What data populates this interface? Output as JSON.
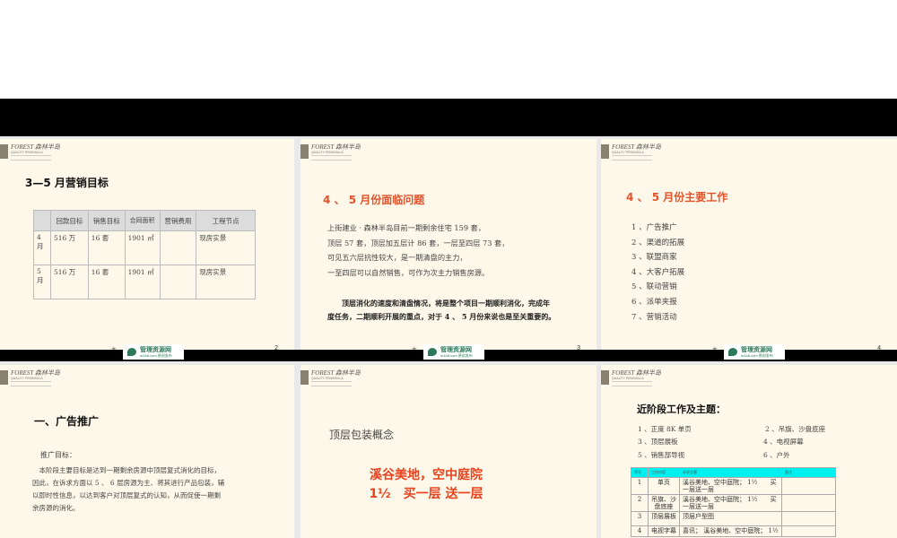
{
  "logo": {
    "brand": "FOREST 森林半岛",
    "sub": "QUALITY PENINSULA"
  },
  "watermark": {
    "name": "管理资源网",
    "url": "m448.com 原创发布"
  },
  "footer_text": "- 本",
  "slide2": {
    "title": "3—5 月营销目标",
    "page": "2",
    "table": {
      "headers": [
        "",
        "回款目标",
        "销售目标",
        "合同面积",
        "营销费用",
        "工程节点"
      ],
      "rows": [
        [
          "4月",
          "516 万",
          "16 套",
          "1901 ㎡",
          "",
          "现房实景"
        ],
        [
          "5月",
          "516 万",
          "16 套",
          "1901 ㎡",
          "",
          "现房实景"
        ]
      ]
    }
  },
  "slide3": {
    "title": "4 、 5 月份面临问题",
    "page": "3",
    "lines": [
      "上街建业 · 森林半岛目前一期剩余住宅 159 套，",
      "顶层 57 套，顶层加五层计 86 套，一层至四层 73 套，",
      "可见五六层抗性较大，是一期清盘的主力，",
      "一至四层可以自然销售，可作为次主力销售房源。"
    ],
    "bold_lines": [
      "　　顶层消化的速度和清盘情况，将是整个项目一期顺利消化，完成年",
      "度任务，二期顺利开展的重点，对于 4 、 5 月份来说也是至关重要的。"
    ]
  },
  "slide4": {
    "title": "4 、 5 月份主要工作",
    "page": "4",
    "items": [
      "1 、广告推广",
      "2 、渠道的拓展",
      "3 、联盟商家",
      "4 、大客户拓展",
      "5 、联动营销",
      "6 、派单夹报",
      "7 、营销活动"
    ]
  },
  "slide5": {
    "title": "一、广告推广",
    "subtitle": "推广目标：",
    "lines": [
      "　本阶段主要目标是达到一期剩余房源中顶层复式消化的目标，",
      "因此，在诉求方面以 5 、 6 层房源为主、将其进行产品包装，辅",
      "以即时性信息，以达到客户对顶层复式的认知，从而促使一期剩",
      "余房源的消化。"
    ]
  },
  "slide6": {
    "title": "顶层包装概念",
    "slogan1": "溪谷美地，空中庭院",
    "slogan2": "1½　买一层 送一层"
  },
  "slide7": {
    "title": "近阶段工作及主题：",
    "items": [
      "1 、正度 8K 单页",
      "2 、吊旗、沙盘底座",
      "3 、顶层展板",
      "4 、电视屏幕",
      "5 、销售部导视",
      "6 、户外"
    ],
    "table": {
      "headers": [
        "序号",
        "工作内容",
        "诉求主题",
        "备注"
      ],
      "rows": [
        [
          "1",
          "单页",
          "溪谷美地、空中庭院； 1½　　买一层送一层",
          ""
        ],
        [
          "2",
          "吊旗、沙盘底座",
          "溪谷美地、空中庭院； 1½　　买一层送一层",
          ""
        ],
        [
          "3",
          "顶层展板",
          "顶层户型图",
          ""
        ],
        [
          "4",
          "电视字幕",
          "喜讯； 溪谷美地、空中庭院； 1½",
          ""
        ]
      ]
    }
  }
}
